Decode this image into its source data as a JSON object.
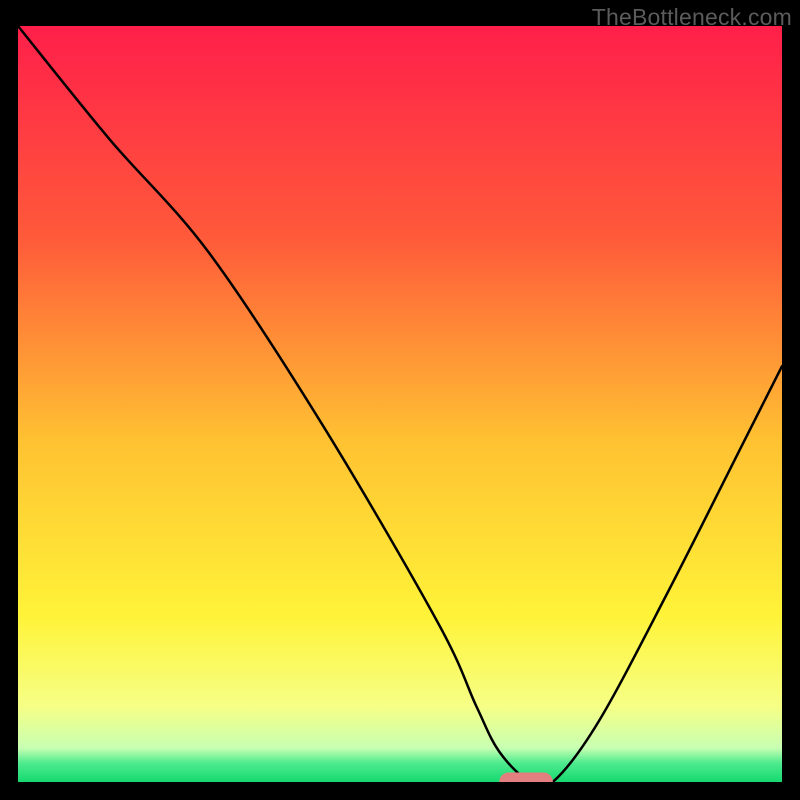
{
  "watermark": "TheBottleneck.com",
  "chart_data": {
    "type": "line",
    "title": "",
    "xlabel": "",
    "ylabel": "",
    "xlim": [
      0,
      100
    ],
    "ylim": [
      0,
      100
    ],
    "background_gradient": {
      "stops": [
        {
          "offset": 0.0,
          "color": "#ff1f4a"
        },
        {
          "offset": 0.28,
          "color": "#ff5a3a"
        },
        {
          "offset": 0.55,
          "color": "#ffc232"
        },
        {
          "offset": 0.78,
          "color": "#fff338"
        },
        {
          "offset": 0.9,
          "color": "#f6ff86"
        },
        {
          "offset": 0.955,
          "color": "#c8ffb2"
        },
        {
          "offset": 0.975,
          "color": "#4eeb8e"
        },
        {
          "offset": 1.0,
          "color": "#15d96f"
        }
      ]
    },
    "series": [
      {
        "name": "bottleneck-curve",
        "color": "#000000",
        "x": [
          0,
          12,
          25,
          40,
          55,
          60,
          63,
          67,
          70,
          76,
          85,
          95,
          100
        ],
        "values": [
          100,
          85,
          70,
          47,
          21,
          10,
          4,
          0,
          0,
          8,
          25,
          45,
          55
        ]
      }
    ],
    "marker": {
      "name": "optimal-band",
      "color": "#e37f7f",
      "x_start": 63,
      "x_end": 70,
      "y": 0,
      "thickness": 2.5
    }
  },
  "colors": {
    "frame": "#000000",
    "watermark": "#5b5b5b"
  }
}
